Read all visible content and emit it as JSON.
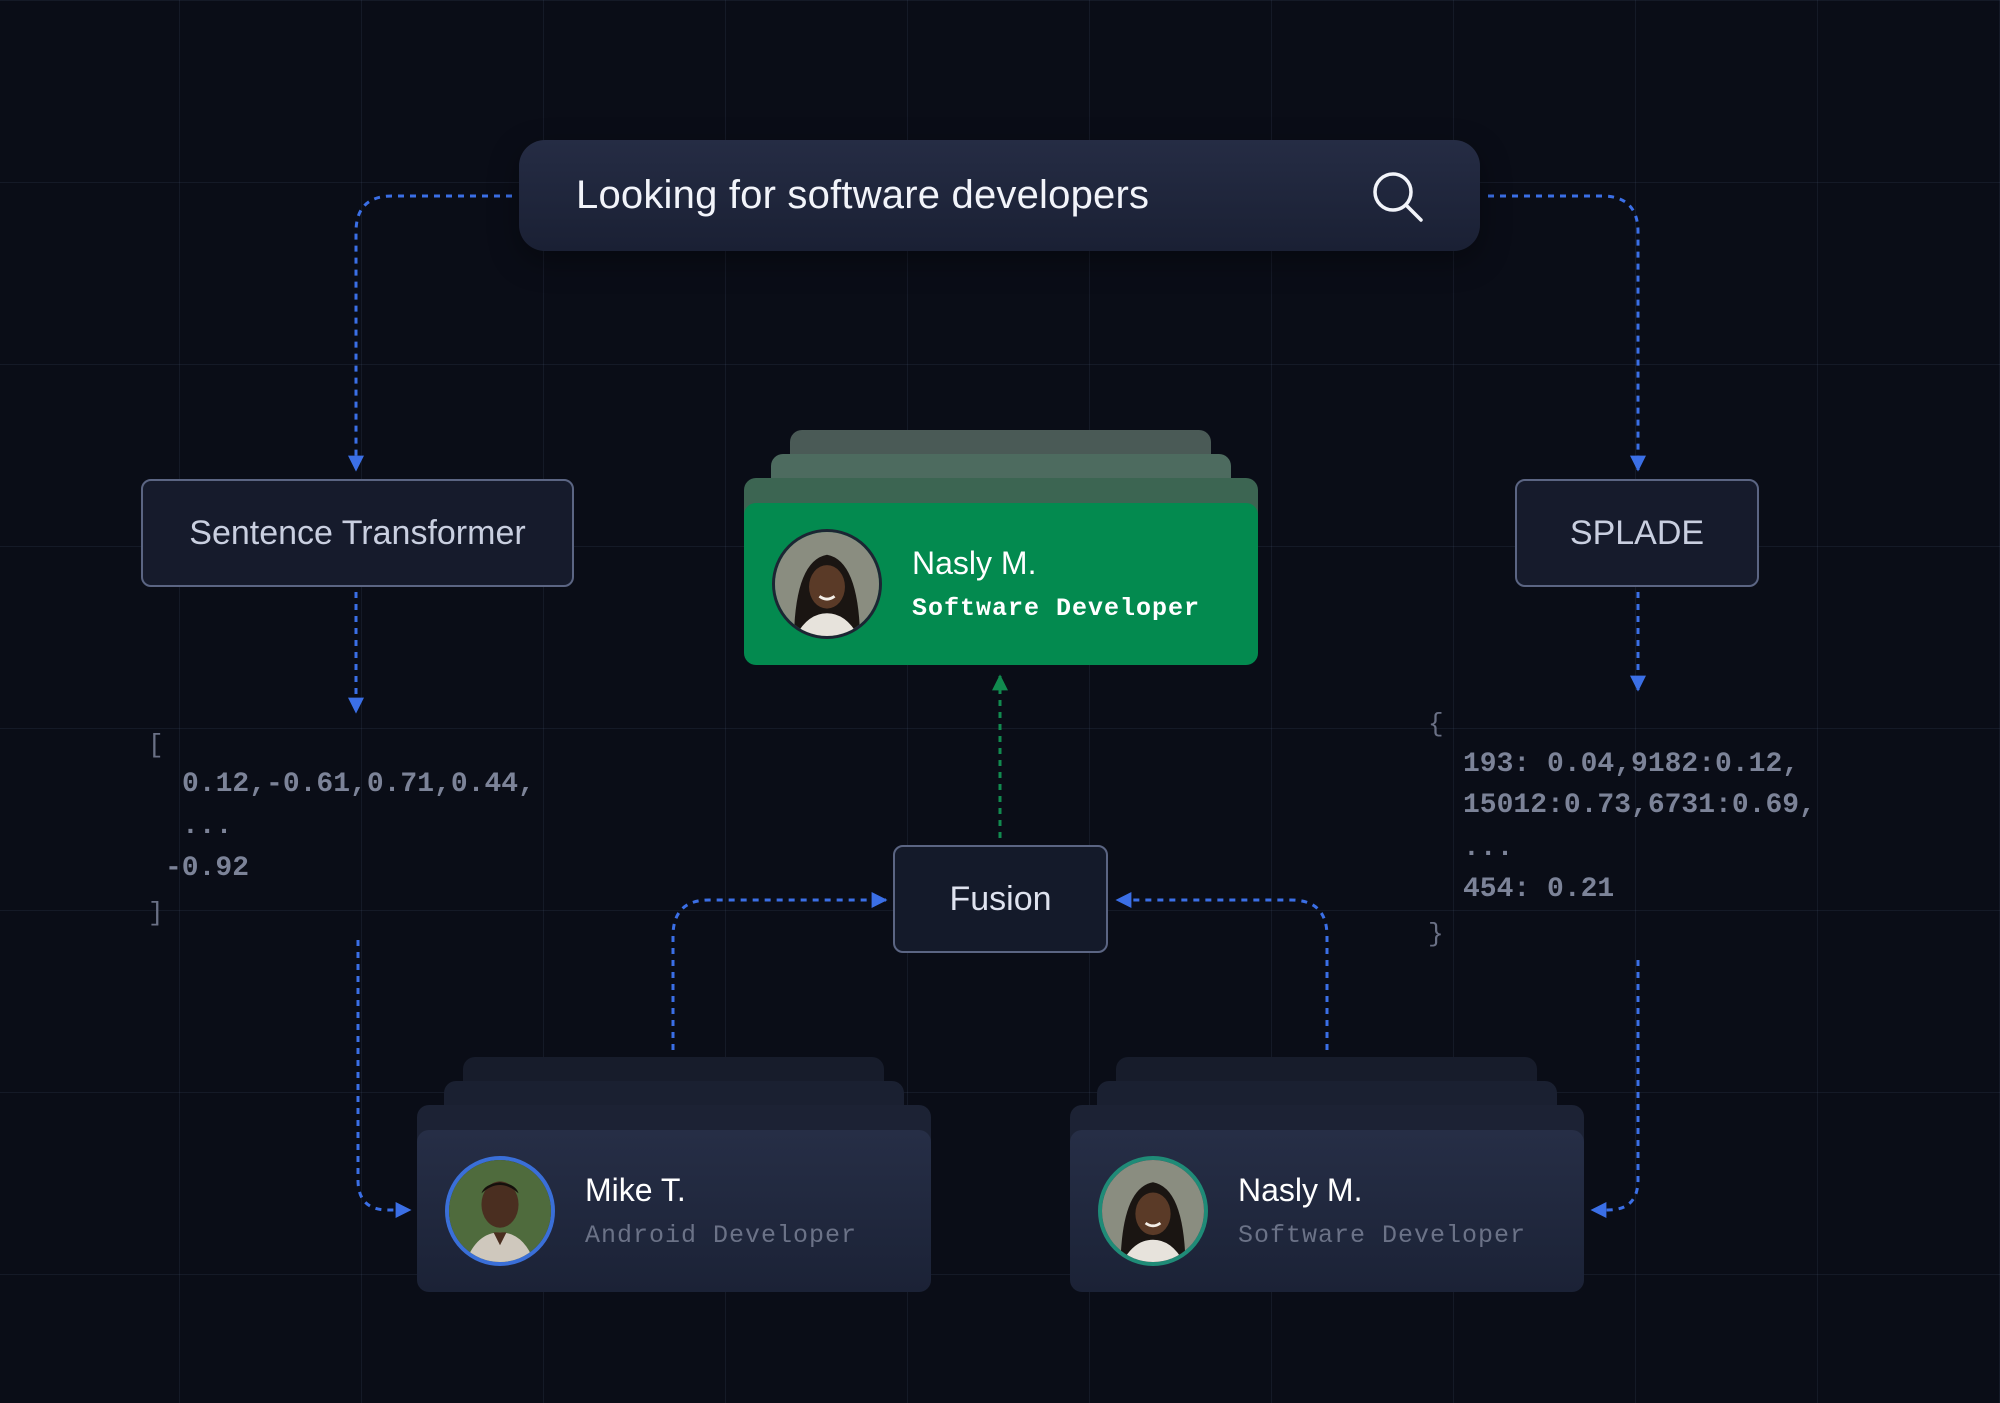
{
  "search": {
    "query": "Looking for software developers",
    "icon": "search-icon"
  },
  "models": {
    "dense": "Sentence Transformer",
    "sparse": "SPLADE",
    "fusion": "Fusion"
  },
  "dense_vector": {
    "open": "[",
    "line1": "0.12,-0.61,0.71,0.44,",
    "line2": "...",
    "line3": "-0.92",
    "close": "]"
  },
  "sparse_vector": {
    "open": "{",
    "line1": "193: 0.04,9182:0.12,",
    "line2": "15012:0.73,6731:0.69,",
    "line3": "...",
    "line4": "454: 0.21",
    "close": "}"
  },
  "results": {
    "fused": {
      "name": "Nasly M.",
      "role": "Software Developer"
    },
    "dense": {
      "name": "Mike T.",
      "role": "Android Developer"
    },
    "sparse": {
      "name": "Nasly M.",
      "role": "Software Developer"
    }
  },
  "colors": {
    "background": "#0a0d17",
    "flow_arrow": "#3b6fe6",
    "fusion_arrow": "#118a4f",
    "result_highlight": "#038a4f"
  }
}
